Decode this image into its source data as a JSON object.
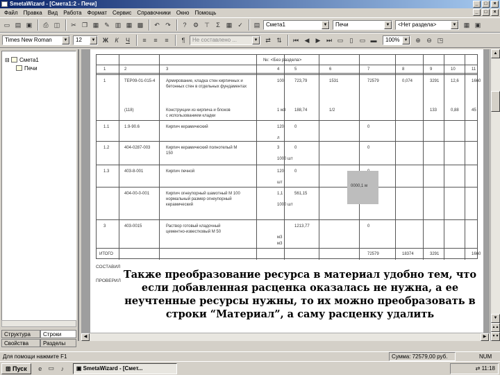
{
  "window": {
    "title": "SmetaWizard - [Смета1:2 - Печи]"
  },
  "menu": [
    "Файл",
    "Правка",
    "Вид",
    "Работа",
    "Формат",
    "Сервис",
    "Справочники",
    "Окно",
    "Помощь"
  ],
  "toolbar": {
    "smeta_combo": "Смета1",
    "section_combo": "Печи",
    "noraz_combo": "<Нет раздела>",
    "font_combo": "Times New Roman",
    "size_combo": "12",
    "style_combo": "Не составлено ...",
    "zoom_combo": "100%"
  },
  "tree": {
    "root": "Смета1",
    "child": "Печи"
  },
  "left_tabs": [
    "Структура",
    "Строки",
    "Свойства",
    "Разделы"
  ],
  "table": {
    "section_header": "№: <Без раздела>",
    "header_nums": [
      "1",
      "2",
      "3",
      "4",
      "5",
      "6",
      "7",
      "8",
      "9",
      "10",
      "11"
    ],
    "rows": [
      {
        "num": "1",
        "code": "ТЕР09-01-015-4",
        "name": "Армирование, кладка стен кирпичных и",
        "name2": "бетонных стен в отдельных фундаментах",
        "qty": "100",
        "price": "723,79",
        "total": "1531",
        "c7": "72579",
        "c8": "0,074",
        "c9": "3291",
        "c10": "12,6",
        "c11": "1660"
      },
      {
        "num": "",
        "code": "(118)",
        "name": "Конструкции из кирпича и блоков",
        "name2": "с использованием кладки",
        "qty": "1 м3",
        "price": "188,74",
        "total": "1/2",
        "c7": "",
        "c8": "",
        "c9": "133",
        "c10": "0,88",
        "c11": "45"
      },
      {
        "num": "1.1",
        "code": "1.9-90.6",
        "name": "Кирпич керамический",
        "qty": "120",
        "price": "0",
        "total": "",
        "c7": "0",
        "subq": "л"
      },
      {
        "num": "1.2",
        "code": "404-0287-003",
        "name": "Кирпич керамический полнотелый М",
        "name2": "150",
        "qty": "3",
        "price": "0",
        "c7": "0",
        "subq": "1000 шт"
      },
      {
        "num": "1.3",
        "code": "403-8-001",
        "name": "Кирпич печной",
        "qty": "120",
        "price": "0",
        "c7": "0",
        "subq": "шт"
      },
      {
        "num": "",
        "code": "404-00-0-001",
        "name": "Кирпич огнеупорный шамотный М 100",
        "name2": "нормальный размер огнеупорный",
        "name3": "керамический",
        "qty": "1,1",
        "price": "561,15",
        "c7": "",
        "note": "0000,1 м",
        "subq": "1000 шт"
      },
      {
        "num": "3",
        "code": "403-0015",
        "name": "Раствор готовый кладочный",
        "name2": "цементно-известковый М 50",
        "qty": "",
        "price": "1213,77",
        "c7": "0",
        "subq": "м3"
      }
    ],
    "total_label": "ИТОГО",
    "totals": {
      "c7": "72579",
      "c8": "18374",
      "c9": "3291",
      "c11": "1660"
    },
    "total_sub": "м3",
    "side_labels": [
      "СОСТАВИЛ",
      "ПРОВЕРИЛ"
    ]
  },
  "caption": "Также преобразование ресурса в материал удобно тем, что если добавленная расценка оказалась не нужна, а ее неучтенные ресурсы нужны, то их можно преобразовать в строки “Материал”, а саму расценку удалить",
  "status": {
    "left": "Для помощи нажмите F1",
    "right": "Сумма: 72579,00 руб.",
    "mode": "NUM"
  },
  "taskbar": {
    "start": "Пуск",
    "task": "SmetaWizard - [Смет...",
    "clock": "11:18"
  }
}
